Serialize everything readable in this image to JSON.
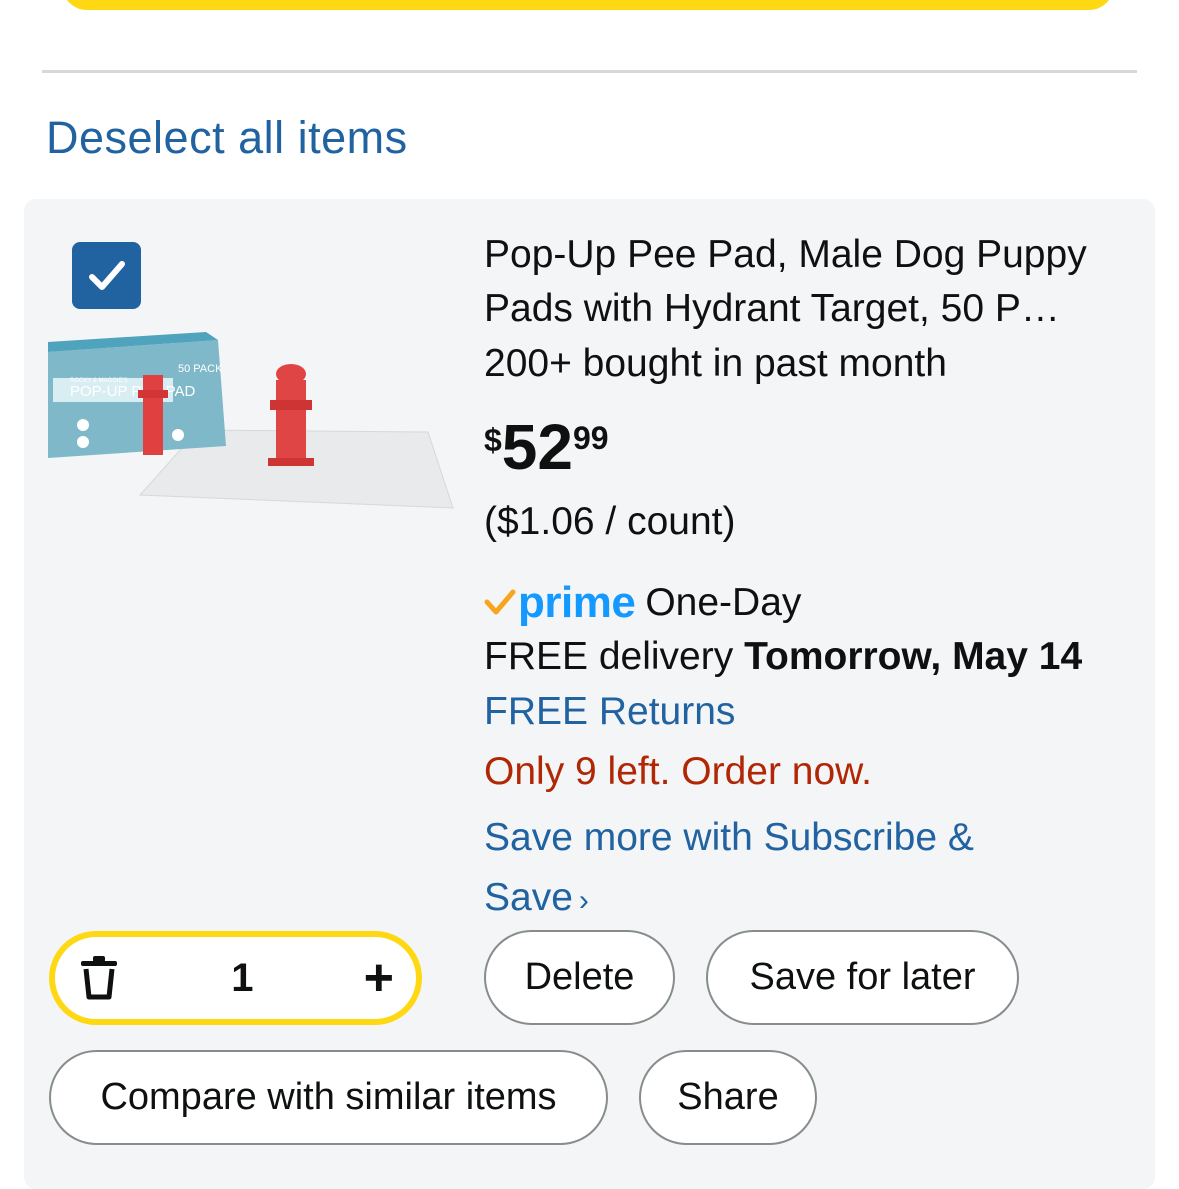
{
  "header": {
    "deselect_label": "Deselect all items"
  },
  "item": {
    "checkbox_checked": true,
    "image_alt": "Pop-Up Pee Pad product box with red hydrant target",
    "image_text": {
      "pack": "50 PACK",
      "brand": "ROCKY & MAGGIE'S",
      "name": "POP-UP PEE PAD"
    },
    "title": "Pop-Up Pee Pad, Male Dog Puppy Pads with Hydrant Target, 50 P…",
    "bought": "200+ bought in past month",
    "price": {
      "symbol": "$",
      "whole": "52",
      "fraction": "99"
    },
    "unit_price": "($1.06 / count)",
    "prime": {
      "label": "prime",
      "suffix": "One-Day"
    },
    "delivery": {
      "prefix": "FREE delivery ",
      "date": "Tomorrow, May 14"
    },
    "returns": "FREE Returns",
    "stock": "Only 9 left. Order now.",
    "subscribe": "Save more with Subscribe & Save",
    "quantity": "1"
  },
  "actions": {
    "delete": "Delete",
    "save_for_later": "Save for later",
    "compare": "Compare with similar items",
    "share": "Share"
  },
  "colors": {
    "accent_yellow": "#ffd814",
    "link_blue": "#2162a1",
    "prime_blue": "#1399ff",
    "prime_check": "#f7a51c",
    "stock_red": "#b12704"
  }
}
